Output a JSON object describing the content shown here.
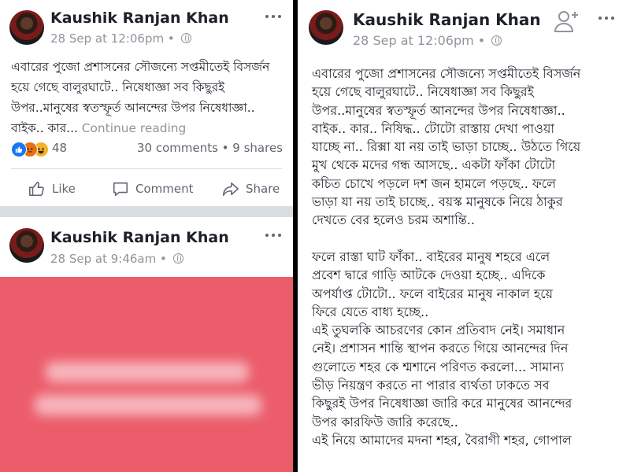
{
  "post1": {
    "author": "Kaushik Ranjan Khan",
    "timestamp": "28 Sep at 12:06pm",
    "body": "এবারের পুজো প্রশাসনের সৌজন্যে সপ্তমীতেই বিসর্জন\nহয়ে গেছে বালুরঘাটে.. নিষেধাজ্ঞা সব কিছুরই\nউপর..মানুষের স্বতস্ফূর্ত আনন্দের উপর নিষেধাজ্ঞা..\nবাইক.. কার...",
    "continue_label": "Continue reading",
    "reaction_count": "48",
    "stats": "30 comments • 9 shares",
    "actions": {
      "like": "Like",
      "comment": "Comment",
      "share": "Share"
    }
  },
  "post2": {
    "author": "Kaushik Ranjan Khan",
    "timestamp": "28 Sep at 9:46am"
  },
  "expanded": {
    "author": "Kaushik Ranjan Khan",
    "timestamp": "28 Sep at 12:06pm",
    "body": "এবারের পুজো প্রশাসনের সৌজন্যে সপ্তমীতেই বিসর্জন\nহয়ে গেছে বালুরঘাটে.. নিষেধাজ্ঞা সব কিছুরই\nউপর..মানুষের স্বতস্ফূর্ত আনন্দের উপর নিষেধাজ্ঞা..\nবাইক.. কার.. নিষিদ্ধ.. টোটো রাস্তায় দেখা পাওয়া\nযাচ্ছে না.. রিক্সা যা নয় তাই ভাড়া চাচ্ছে.. উঠতে গিয়ে\nমুখ থেকে মদের গন্ধ আসছে.. একটা ফাঁকা টোটো\nকচিত চোখে পড়লে দশ জন হামলে পড়ছে.. ফলে\nভাড়া যা নয় তাই চাচ্ছে.. বয়স্ক মানুষকে নিয়ে ঠাকুর\nদেখতে বের হলেও চরম অশান্তি..\n\nফলে রাস্তা ঘাট ফাঁকা.. বাইরের মানুষ শহরে এলে\nপ্রবেশ দ্বারে গাড়ি আটকে দেওয়া হচ্ছে.. এদিকে\nঅপর্যাপ্ত টোটো.. ফলে বাইরের মানুষ নাকাল হয়ে\nফিরে যেতে বাধ্য হচ্ছে..\nএই তুঘলকি আচরণের কোন প্রতিবাদ নেই। সমাধান\nনেই। প্রশাসন শান্তি স্থাপন করতে গিয়ে আনন্দের দিন\nগুলোতে শহর কে শ্মশানে পরিণত করলো... সামান্য\nভীড় নিয়ন্ত্রণ করতে না পারার ব্যর্থতা ঢাকতে সব\nকিছুরই উপর নিষেধাজ্ঞা জারি করে মানুষের আনন্দের\nউপর কারফিউ জারি করেছে..\nএই নিয়ে আমাদের মদনা শহর, বৈরাগী শহর, গোপাল"
  },
  "icons": {
    "reaction_like": "like-reaction-icon",
    "reaction_angry": "angry-reaction-icon",
    "reaction_haha": "haha-reaction-icon",
    "like": "thumbs-up-icon",
    "comment": "speech-bubble-icon",
    "share": "share-arrow-icon",
    "globe": "globe-icon",
    "more": "more-dots-icon",
    "add_friend": "add-friend-icon"
  },
  "colors": {
    "link_blue": "#365899",
    "meta_gray": "#90949c",
    "shared_image_bg": "#ec5d6c",
    "like_blue": "#1877f2"
  }
}
